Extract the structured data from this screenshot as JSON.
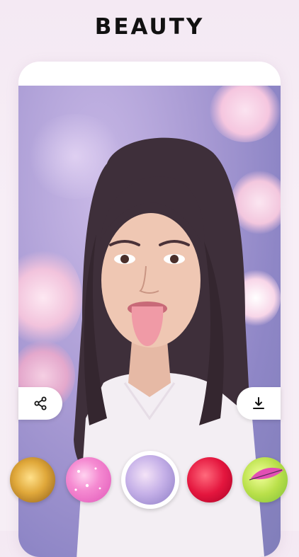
{
  "headline": "BEAUTY",
  "phone": {
    "photo_subject": "portrait-photo",
    "actions": {
      "share_icon": "share-icon",
      "download_icon": "download-icon"
    }
  },
  "effects": [
    {
      "name": "effect-golden-bubbles",
      "color": "#e0a83a"
    },
    {
      "name": "effect-pink-sparkles",
      "color": "#f06ac0"
    },
    {
      "name": "effect-cherry-blossom",
      "color": "#b59ae0",
      "selected": true
    },
    {
      "name": "effect-red-hearts",
      "color": "#e4163e"
    },
    {
      "name": "effect-lime-feather",
      "color": "#b9e04a"
    }
  ],
  "colors": {
    "background": "#f4e9f3",
    "headline": "#111111",
    "card": "#ffffff",
    "selection_ring": "#ffffff"
  }
}
